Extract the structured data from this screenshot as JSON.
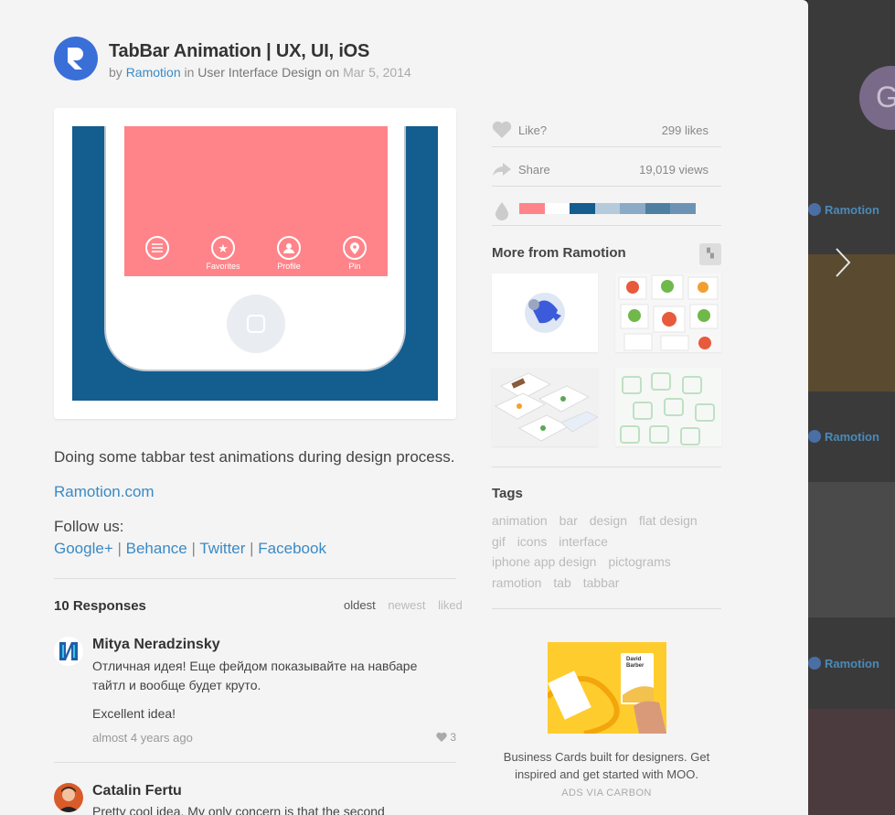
{
  "shot": {
    "title": "TabBar Animation | UX, UI, iOS",
    "by": "by",
    "author": "Ramotion",
    "in": "in",
    "category": "User Interface Design",
    "on": "on",
    "date": "Mar 5, 2014"
  },
  "tabbar": {
    "tabs": [
      {
        "label": "",
        "icon": "menu-icon"
      },
      {
        "label": "Favorites",
        "icon": "star-icon"
      },
      {
        "label": "Profile",
        "icon": "profile-icon"
      },
      {
        "label": "Pin",
        "icon": "pin-icon"
      }
    ]
  },
  "description": {
    "text": "Doing some tabbar test animations during design process.",
    "site_link": "Ramotion.com",
    "follow_label": "Follow us:",
    "social": [
      "Google+",
      "Behance",
      "Twitter",
      "Facebook"
    ],
    "separator": "|"
  },
  "responses": {
    "heading": "10 Responses",
    "sort": [
      "oldest",
      "newest",
      "liked"
    ],
    "active_sort": "oldest",
    "comments": [
      {
        "name": "Mitya Neradzinsky",
        "text_ru": "Отличная идея! Еще фейдом показывайте на навбаре тайтл и вообще будет круто.",
        "text_en": "Excellent idea!",
        "time": "almost 4 years ago",
        "likes": "3"
      },
      {
        "name": "Catalin Fertu",
        "text": "Pretty cool idea. My only concern is that the second"
      }
    ]
  },
  "stats": {
    "like_label": "Like?",
    "likes": "299 likes",
    "share_label": "Share",
    "views": "19,019 views"
  },
  "palette": [
    "#ff848a",
    "#ffffff",
    "#135d8f",
    "#b5cadb",
    "#8aaac6",
    "#4f7fa0",
    "#6d93b4"
  ],
  "more": {
    "title": "More from Ramotion"
  },
  "tags": {
    "title": "Tags",
    "items": [
      "animation",
      "bar",
      "design",
      "flat design",
      "gif",
      "icons",
      "interface",
      "iphone app design",
      "pictograms",
      "ramotion",
      "tab",
      "tabbar"
    ]
  },
  "ad": {
    "text": "Business Cards built for designers. Get inspired and get started with MOO.",
    "via": "ADS VIA CARBON",
    "card_name": "David Barber"
  },
  "backdrop": {
    "author_label": "Ramotion",
    "avatar_letter": "G"
  }
}
